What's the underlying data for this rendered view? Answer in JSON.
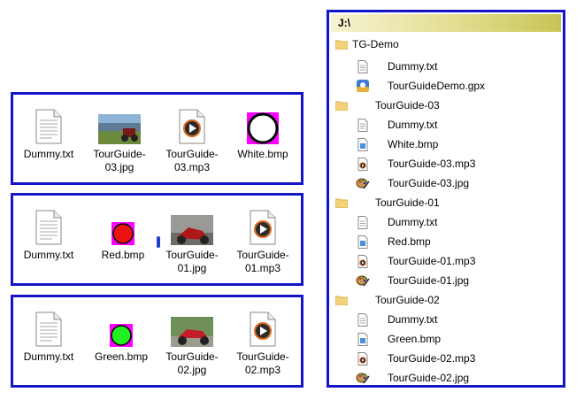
{
  "panels": [
    {
      "items": [
        {
          "label": "Dummy.txt",
          "icon": "text-file-icon"
        },
        {
          "label": "TourGuide-\n03.jpg",
          "icon": "photo-thumbnail-lake"
        },
        {
          "label": "TourGuide-\n03.mp3",
          "icon": "audio-file-icon"
        },
        {
          "label": "White.bmp",
          "icon": "white-circle-bitmap"
        }
      ]
    },
    {
      "items": [
        {
          "label": "Dummy.txt",
          "icon": "text-file-icon"
        },
        {
          "label": "Red.bmp",
          "icon": "red-circle-bitmap"
        },
        {
          "label": "TourGuide-\n01.jpg",
          "icon": "photo-thumbnail-motorbike"
        },
        {
          "label": "TourGuide-\n01.mp3",
          "icon": "audio-file-icon"
        }
      ]
    },
    {
      "items": [
        {
          "label": "Dummy.txt",
          "icon": "text-file-icon"
        },
        {
          "label": "Green.bmp",
          "icon": "green-circle-bitmap"
        },
        {
          "label": "TourGuide-\n02.jpg",
          "icon": "photo-thumbnail-red-bike"
        },
        {
          "label": "TourGuide-\n02.mp3",
          "icon": "audio-file-icon"
        }
      ]
    }
  ],
  "tree": {
    "root": "J:\\",
    "rows": [
      {
        "label": "TG-Demo",
        "icon": "folder-icon"
      },
      {
        "label": "Dummy.txt",
        "icon": "text-file-icon"
      },
      {
        "label": "TourGuideDemo.gpx",
        "icon": "gpx-app-icon"
      },
      {
        "label": "TourGuide-03",
        "icon": "folder-icon"
      },
      {
        "label": "Dummy.txt",
        "icon": "text-file-icon"
      },
      {
        "label": "White.bmp",
        "icon": "bitmap-file-icon"
      },
      {
        "label": "TourGuide-03.mp3",
        "icon": "audio-file-icon"
      },
      {
        "label": "TourGuide-03.jpg",
        "icon": "image-file-icon"
      },
      {
        "label": "TourGuide-01",
        "icon": "folder-icon"
      },
      {
        "label": "Dummy.txt",
        "icon": "text-file-icon"
      },
      {
        "label": "Red.bmp",
        "icon": "bitmap-file-icon"
      },
      {
        "label": "TourGuide-01.mp3",
        "icon": "audio-file-icon"
      },
      {
        "label": "TourGuide-01.jpg",
        "icon": "image-file-icon"
      },
      {
        "label": "TourGuide-02",
        "icon": "folder-icon"
      },
      {
        "label": "Dummy.txt",
        "icon": "text-file-icon"
      },
      {
        "label": "Green.bmp",
        "icon": "bitmap-file-icon"
      },
      {
        "label": "TourGuide-02.mp3",
        "icon": "audio-file-icon"
      },
      {
        "label": "TourGuide-02.jpg",
        "icon": "image-file-icon"
      }
    ]
  },
  "colors": {
    "panel_border": "#1414c8",
    "header_gradient_end": "#c8c456"
  }
}
